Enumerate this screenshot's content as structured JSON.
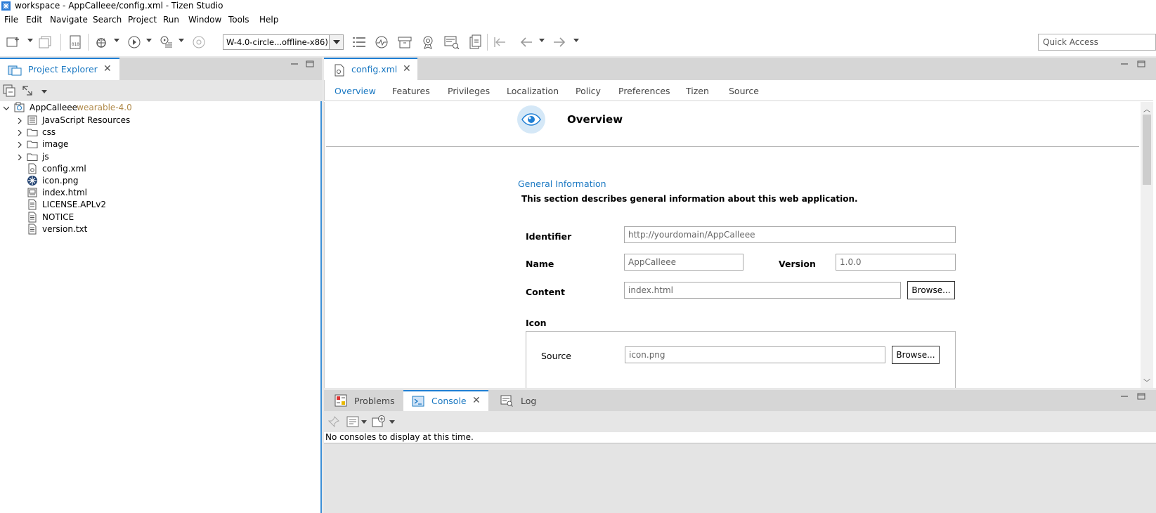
{
  "window": {
    "title": "workspace - AppCalleee/config.xml - Tizen Studio"
  },
  "menu": [
    "File",
    "Edit",
    "Navigate",
    "Search",
    "Project",
    "Run",
    "Window",
    "Tools",
    "Help"
  ],
  "toolbar": {
    "target_device": "W-4.0-circle...offline-x86)",
    "quick_access_placeholder": "Quick Access"
  },
  "project_explorer": {
    "tab_label": "Project Explorer",
    "project": {
      "name": "AppCalleee",
      "suffix": " - wearable-4.0"
    },
    "items": [
      {
        "label": "JavaScript Resources",
        "icon": "library-icon",
        "expandable": true
      },
      {
        "label": "css",
        "icon": "folder-icon",
        "expandable": true
      },
      {
        "label": "image",
        "icon": "folder-icon",
        "expandable": true
      },
      {
        "label": "js",
        "icon": "folder-icon",
        "expandable": true
      },
      {
        "label": "config.xml",
        "icon": "config-file-icon",
        "expandable": false
      },
      {
        "label": "icon.png",
        "icon": "tizen-image-icon",
        "expandable": false
      },
      {
        "label": "index.html",
        "icon": "html-file-icon",
        "expandable": false
      },
      {
        "label": "LICENSE.APLv2",
        "icon": "text-file-icon",
        "expandable": false
      },
      {
        "label": "NOTICE",
        "icon": "text-file-icon",
        "expandable": false
      },
      {
        "label": "version.txt",
        "icon": "text-file-icon",
        "expandable": false
      }
    ]
  },
  "editor": {
    "tab_label": "config.xml",
    "subtabs": [
      "Overview",
      "Features",
      "Privileges",
      "Localization",
      "Policy",
      "Preferences",
      "Tizen",
      "Source"
    ],
    "active_subtab": "Overview",
    "page_title": "Overview",
    "section_title": "General Information",
    "section_desc": "This section describes general information about this web application.",
    "identifier_label": "Identifier",
    "identifier_value": "http://yourdomain/AppCalleee",
    "name_label": "Name",
    "name_value": "AppCalleee",
    "version_label": "Version",
    "version_value": "1.0.0",
    "content_label": "Content",
    "content_value": "index.html",
    "browse_label": "Browse...",
    "icon_label": "Icon",
    "source_label": "Source",
    "source_value": "icon.png"
  },
  "bottom_panel": {
    "tabs": [
      {
        "label": "Problems"
      },
      {
        "label": "Console"
      },
      {
        "label": "Log"
      }
    ],
    "active_tab": "Console",
    "message": "No consoles to display at this time."
  },
  "colors": {
    "accent": "#1a78c2",
    "link_blue": "#1f7fd4",
    "project_suffix": "#b08a4a"
  }
}
